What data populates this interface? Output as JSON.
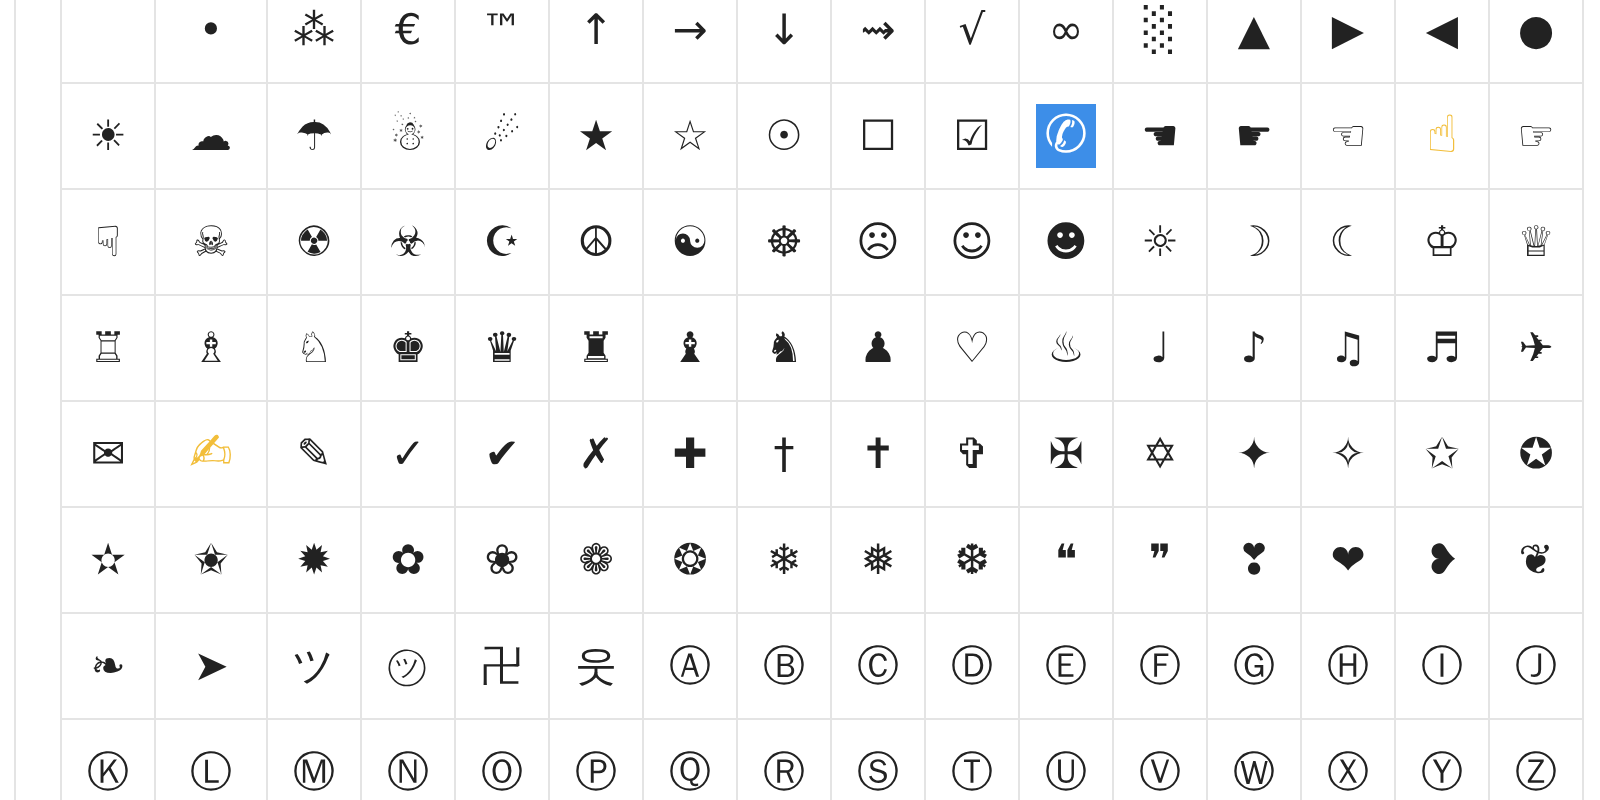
{
  "rows": [
    [
      {
        "kind": "blank"
      },
      {
        "symbol": "•"
      },
      {
        "symbol": "⁂"
      },
      {
        "symbol": "€"
      },
      {
        "symbol": "™"
      },
      {
        "symbol": "↑"
      },
      {
        "symbol": "→"
      },
      {
        "symbol": "↓"
      },
      {
        "symbol": "⇝"
      },
      {
        "symbol": "√"
      },
      {
        "symbol": "∞"
      },
      {
        "symbol": "░"
      },
      {
        "symbol": "▲"
      },
      {
        "symbol": "▶"
      },
      {
        "symbol": "◀"
      },
      {
        "symbol": "●"
      }
    ],
    [
      {
        "symbol": "☀"
      },
      {
        "symbol": "☁"
      },
      {
        "symbol": "☂"
      },
      {
        "symbol": "☃"
      },
      {
        "symbol": "☄"
      },
      {
        "symbol": "★"
      },
      {
        "symbol": "☆"
      },
      {
        "symbol": "☉"
      },
      {
        "symbol": "☐"
      },
      {
        "symbol": "☑"
      },
      {
        "symbol": "✆",
        "kind": "tile",
        "color": "#3d8ee8"
      },
      {
        "symbol": "☚"
      },
      {
        "symbol": "☛"
      },
      {
        "symbol": "☜"
      },
      {
        "symbol": "☝",
        "kind": "emoji",
        "color": "#f2be3a"
      },
      {
        "symbol": "☞"
      }
    ],
    [
      {
        "symbol": "☟"
      },
      {
        "symbol": "☠"
      },
      {
        "symbol": "☢"
      },
      {
        "symbol": "☣"
      },
      {
        "symbol": "☪"
      },
      {
        "symbol": "☮"
      },
      {
        "symbol": "☯"
      },
      {
        "symbol": "☸"
      },
      {
        "symbol": "☹"
      },
      {
        "symbol": "☺"
      },
      {
        "symbol": "☻"
      },
      {
        "symbol": "☼"
      },
      {
        "symbol": "☽"
      },
      {
        "symbol": "☾"
      },
      {
        "symbol": "♔"
      },
      {
        "symbol": "♕"
      }
    ],
    [
      {
        "symbol": "♖"
      },
      {
        "symbol": "♗"
      },
      {
        "symbol": "♘"
      },
      {
        "symbol": "♚"
      },
      {
        "symbol": "♛"
      },
      {
        "symbol": "♜"
      },
      {
        "symbol": "♝"
      },
      {
        "symbol": "♞"
      },
      {
        "symbol": "♟"
      },
      {
        "symbol": "♡"
      },
      {
        "symbol": "♨"
      },
      {
        "symbol": "♩"
      },
      {
        "symbol": "♪"
      },
      {
        "symbol": "♫"
      },
      {
        "symbol": "♬"
      },
      {
        "symbol": "✈"
      }
    ],
    [
      {
        "symbol": "✉"
      },
      {
        "symbol": "✍",
        "kind": "emoji",
        "color": "#f2be3a"
      },
      {
        "symbol": "✎"
      },
      {
        "symbol": "✓"
      },
      {
        "symbol": "✔"
      },
      {
        "symbol": "✗"
      },
      {
        "symbol": "✚"
      },
      {
        "symbol": "†"
      },
      {
        "symbol": "✝"
      },
      {
        "symbol": "✞"
      },
      {
        "symbol": "✠"
      },
      {
        "symbol": "✡"
      },
      {
        "symbol": "✦"
      },
      {
        "symbol": "✧"
      },
      {
        "symbol": "✩"
      },
      {
        "symbol": "✪"
      }
    ],
    [
      {
        "symbol": "✫"
      },
      {
        "symbol": "✬"
      },
      {
        "symbol": "✹"
      },
      {
        "symbol": "✿"
      },
      {
        "symbol": "❀"
      },
      {
        "symbol": "❁"
      },
      {
        "symbol": "❂"
      },
      {
        "symbol": "❄"
      },
      {
        "symbol": "❅"
      },
      {
        "symbol": "❆"
      },
      {
        "symbol": "❝"
      },
      {
        "symbol": "❞"
      },
      {
        "symbol": "❣"
      },
      {
        "symbol": "❤"
      },
      {
        "symbol": "❥"
      },
      {
        "symbol": "❦"
      }
    ],
    [
      {
        "symbol": "❧"
      },
      {
        "symbol": "➤"
      },
      {
        "symbol": "ツ"
      },
      {
        "symbol": "㋡"
      },
      {
        "symbol": "卍"
      },
      {
        "symbol": "웃"
      },
      {
        "symbol": "Ⓐ"
      },
      {
        "symbol": "Ⓑ"
      },
      {
        "symbol": "Ⓒ"
      },
      {
        "symbol": "Ⓓ"
      },
      {
        "symbol": "Ⓔ"
      },
      {
        "symbol": "Ⓕ"
      },
      {
        "symbol": "Ⓖ"
      },
      {
        "symbol": "Ⓗ"
      },
      {
        "symbol": "Ⓘ"
      },
      {
        "symbol": "Ⓙ"
      }
    ],
    [
      {
        "symbol": "Ⓚ"
      },
      {
        "symbol": "Ⓛ"
      },
      {
        "symbol": "Ⓜ"
      },
      {
        "symbol": "Ⓝ"
      },
      {
        "symbol": "Ⓞ"
      },
      {
        "symbol": "Ⓟ"
      },
      {
        "symbol": "Ⓠ"
      },
      {
        "symbol": "Ⓡ"
      },
      {
        "symbol": "Ⓢ"
      },
      {
        "symbol": "Ⓣ"
      },
      {
        "symbol": "Ⓤ"
      },
      {
        "symbol": "Ⓥ"
      },
      {
        "symbol": "Ⓦ"
      },
      {
        "symbol": "Ⓧ"
      },
      {
        "symbol": "Ⓨ"
      },
      {
        "symbol": "Ⓩ"
      }
    ]
  ]
}
